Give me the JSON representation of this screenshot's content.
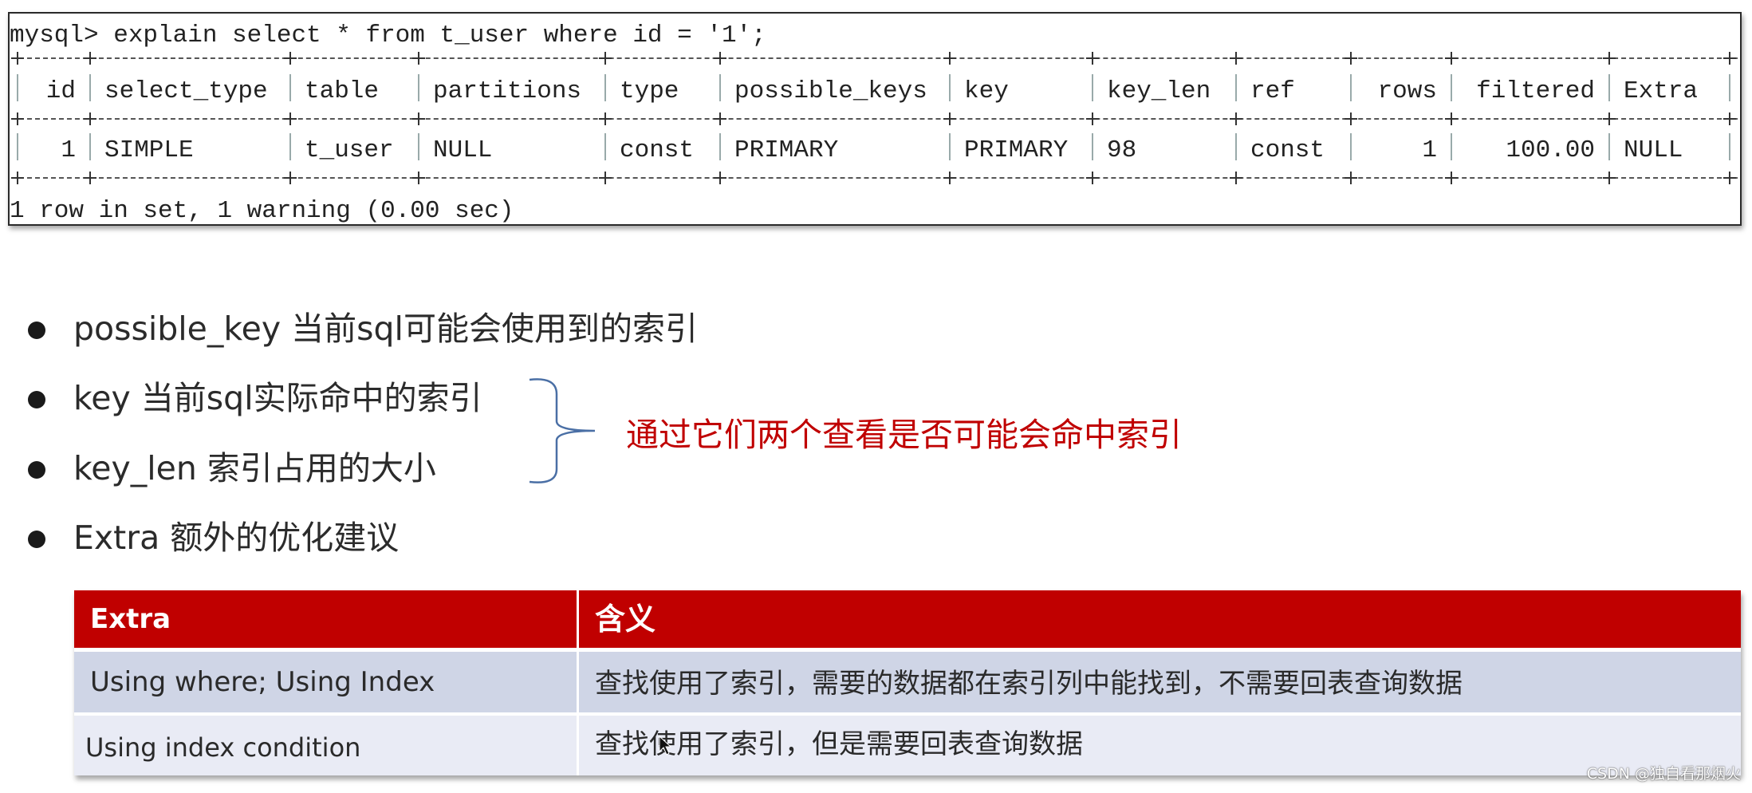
{
  "terminal": {
    "command": "mysql> explain select * from t_user where id = '1';",
    "columns": [
      "id",
      "select_type",
      "table",
      "partitions",
      "type",
      "possible_keys",
      "key",
      "key_len",
      "ref",
      "rows",
      "filtered",
      "Extra"
    ],
    "rows": [
      [
        "1",
        "SIMPLE",
        "t_user",
        "NULL",
        "const",
        "PRIMARY",
        "PRIMARY",
        "98",
        "const",
        "1",
        "100.00",
        "NULL"
      ]
    ],
    "footer": "1 row in set, 1 warning (0.00 sec)"
  },
  "bullets": [
    {
      "label": "possible_key  当前sql可能会使用到的索引"
    },
    {
      "label": "key 当前sql实际命中的索引"
    },
    {
      "label": "key_len 索引占用的大小"
    },
    {
      "label": "Extra 额外的优化建议"
    }
  ],
  "annotation": {
    "text": "通过它们两个查看是否可能会命中索引",
    "color": "#c00000"
  },
  "extra_table": {
    "headers": [
      "Extra",
      "含义"
    ],
    "rows": [
      [
        "Using where; Using Index",
        "查找使用了索引，需要的数据都在索引列中能找到，不需要回表查询数据"
      ],
      [
        "Using index condition",
        "查找使用了索引，但是需要回表查询数据"
      ]
    ],
    "header_color": "#c00000"
  },
  "watermark": "CSDN @独自看那烟火"
}
